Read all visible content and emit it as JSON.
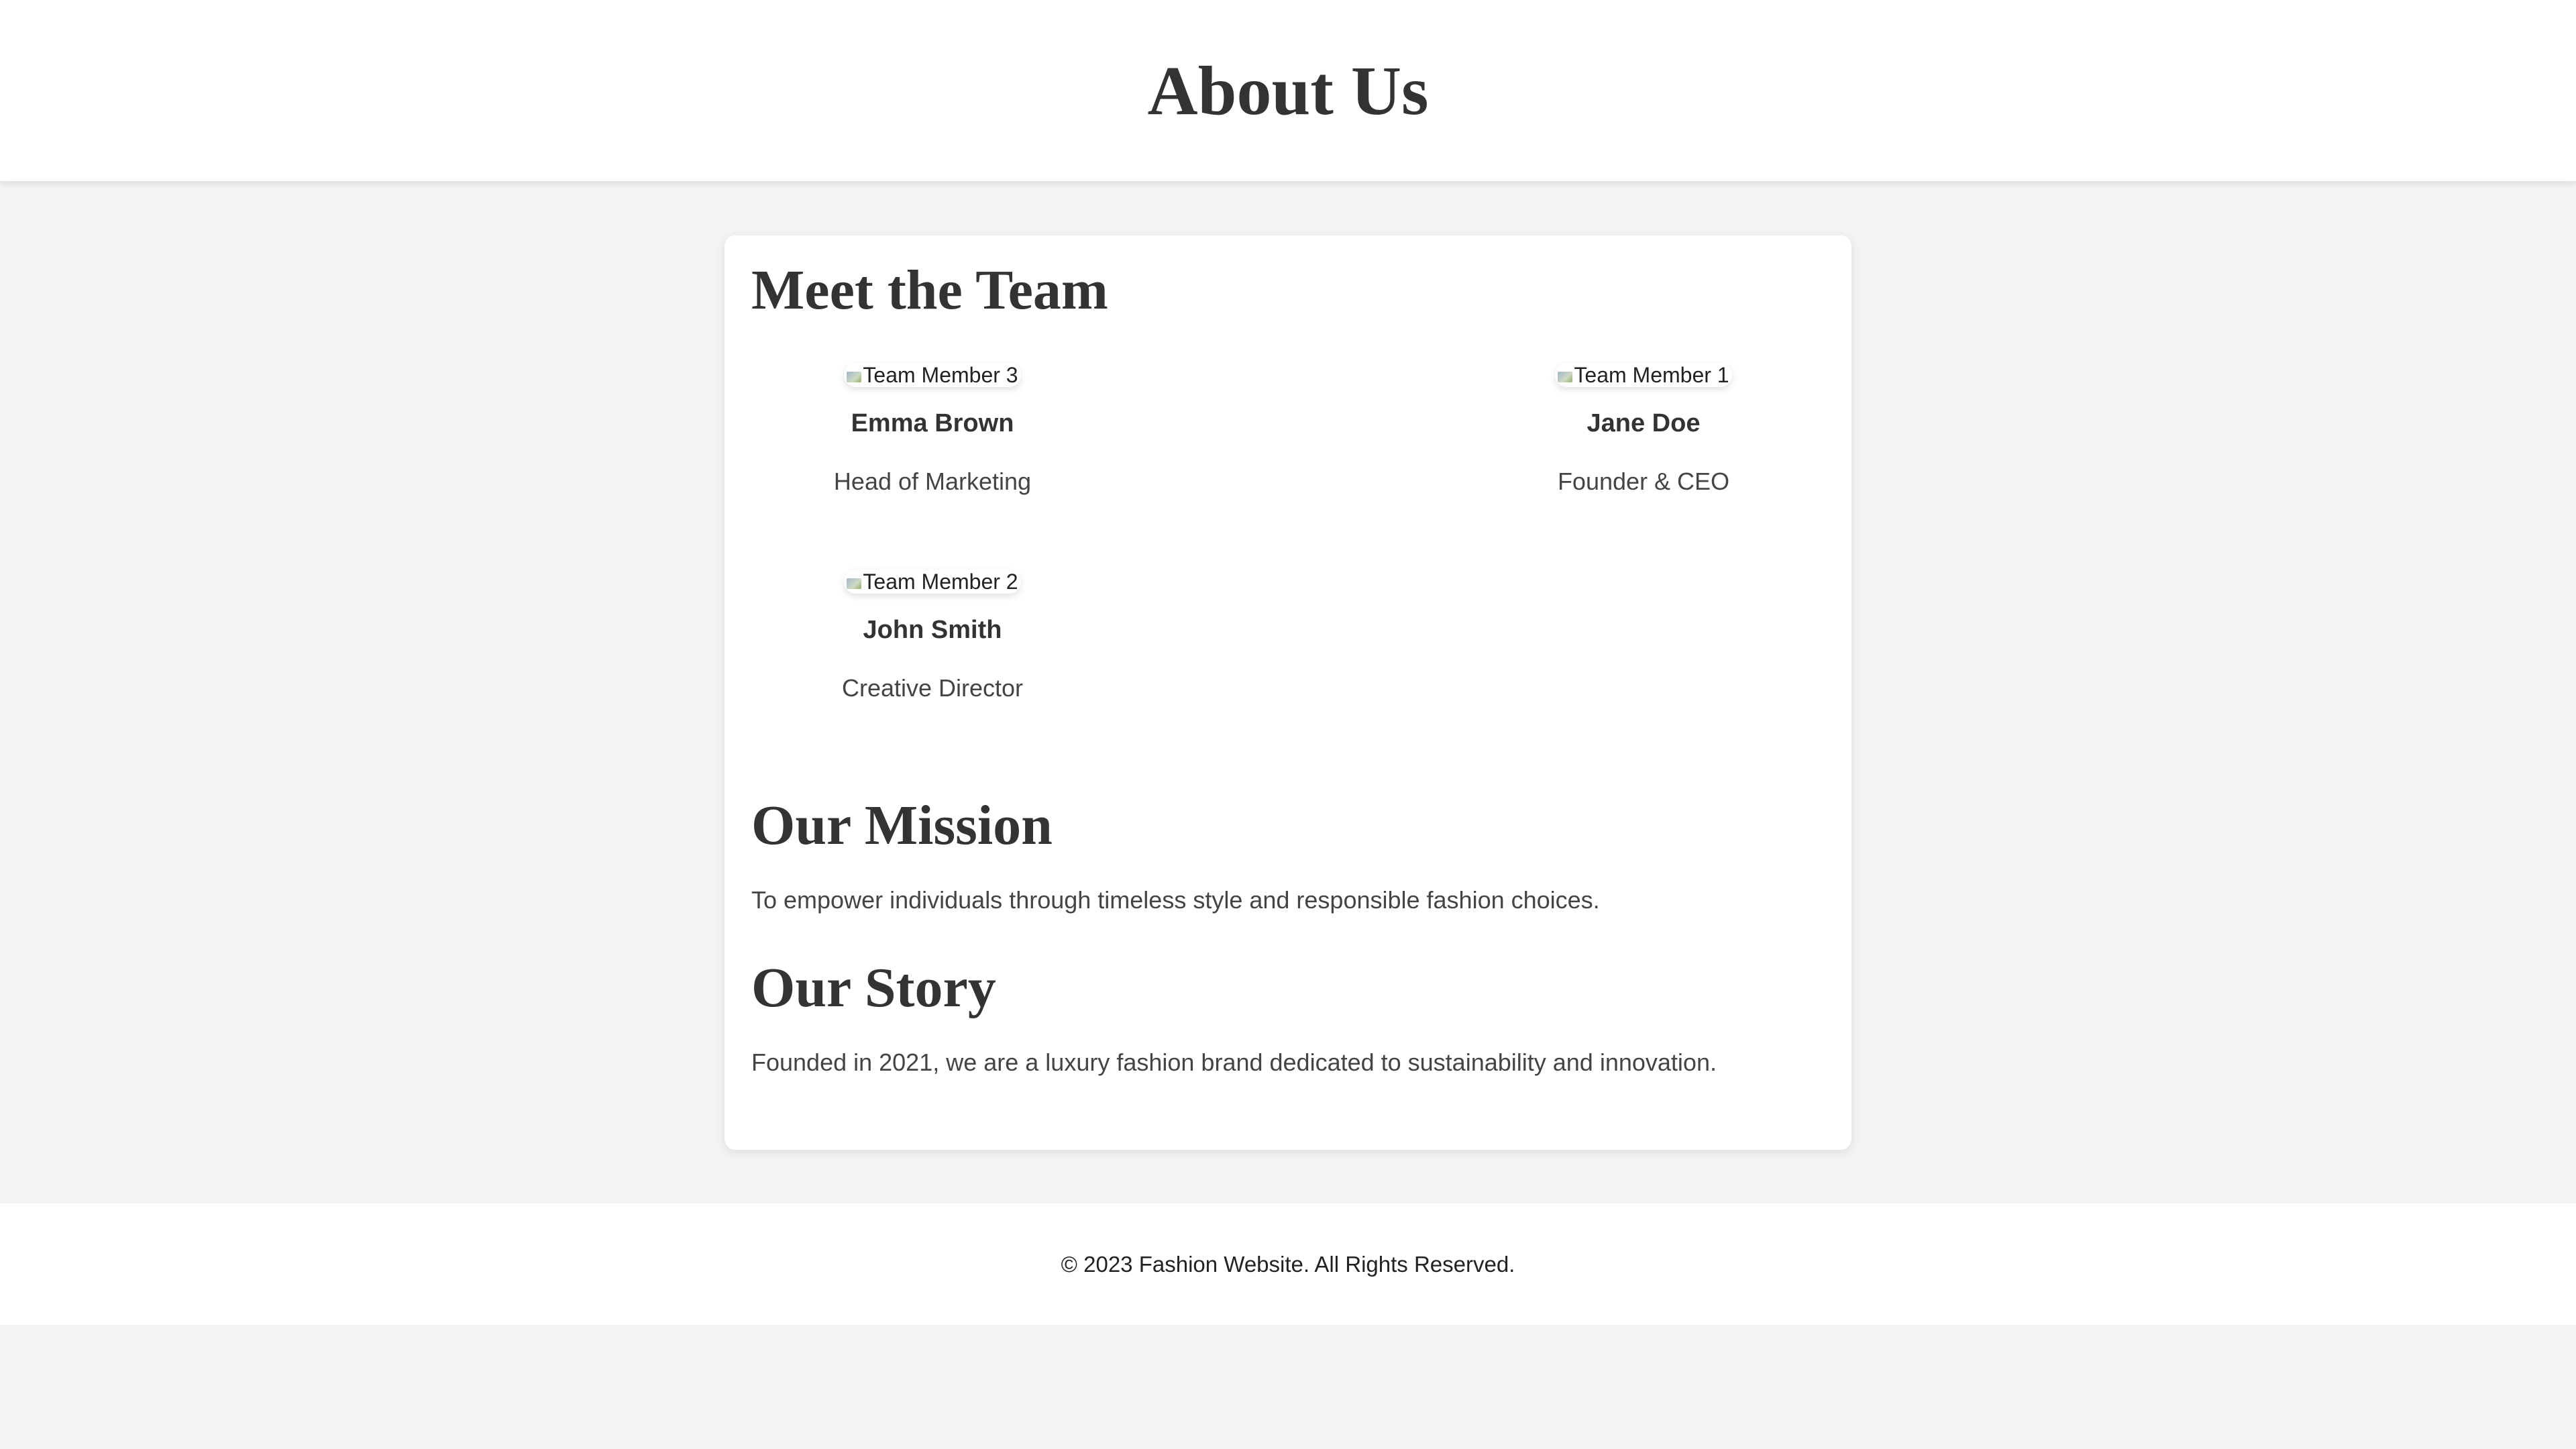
{
  "header": {
    "title": "About Us"
  },
  "team": {
    "title": "Meet the Team",
    "members": [
      {
        "photo_alt": "Team Member 3",
        "name": "Emma Brown",
        "role": "Head of Marketing"
      },
      {
        "photo_alt": "Team Member 1",
        "name": "Jane Doe",
        "role": "Founder & CEO"
      },
      {
        "photo_alt": "Team Member 2",
        "name": "John Smith",
        "role": "Creative Director"
      }
    ]
  },
  "mission": {
    "title": "Our Mission",
    "text": "To empower individuals through timeless style and responsible fashion choices."
  },
  "story": {
    "title": "Our Story",
    "text": "Founded in 2021, we are a luxury fashion brand dedicated to sustainability and innovation."
  },
  "footer": {
    "text": "© 2023 Fashion Website. All Rights Reserved."
  },
  "colors": {
    "page_background": "#f4f4f4",
    "card_background": "#ffffff",
    "text": "#333333"
  }
}
